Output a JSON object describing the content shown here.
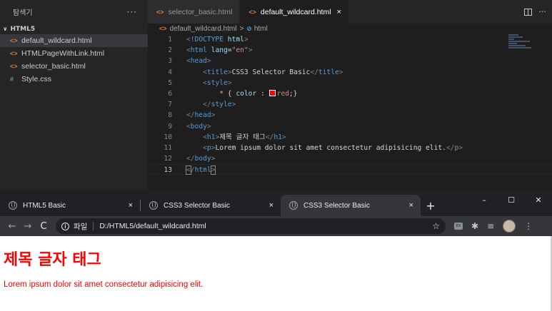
{
  "vscode": {
    "explorer_title": "탐색기",
    "explorer_more": "···",
    "folder_name": "HTML5",
    "files": [
      {
        "name": "default_wildcard.html",
        "type": "html",
        "active": true
      },
      {
        "name": "HTMLPageWithLink.html",
        "type": "html",
        "active": false
      },
      {
        "name": "selector_basic.html",
        "type": "html",
        "active": false
      },
      {
        "name": "Style.css",
        "type": "css",
        "active": false
      }
    ],
    "file_icon_html": "<>",
    "file_icon_css": "#",
    "tabs": [
      {
        "label": "selector_basic.html",
        "active": false
      },
      {
        "label": "default_wildcard.html",
        "active": true
      }
    ],
    "tab_close": "×",
    "tab_more": "···",
    "breadcrumb": {
      "file": "default_wildcard.html",
      "separator": ">",
      "symbol": "html"
    },
    "line_numbers": [
      "1",
      "2",
      "3",
      "4",
      "5",
      "6",
      "7",
      "8",
      "9",
      "10",
      "11",
      "12",
      "13"
    ],
    "current_line": "13",
    "code": {
      "doctype_kw": "!DOCTYPE",
      "doctype_val": "html",
      "html_tag": "html",
      "lang_attr": "lang",
      "lang_val": "\"en\"",
      "head_tag": "head",
      "title_tag": "title",
      "title_text": "CSS3 Selector Basic",
      "style_tag": "style",
      "selector": "*",
      "prop": "color",
      "value": "red",
      "body_tag": "body",
      "h1_tag": "h1",
      "h1_text": "제목 글자 태그",
      "p_tag": "p",
      "p_text": "Lorem ipsum dolor sit amet consectetur adipisicing elit."
    },
    "swatch_color": "#ff0000"
  },
  "chrome": {
    "tabs": [
      {
        "label": "HTML5 Basic",
        "active": false
      },
      {
        "label": "CSS3 Selector Basic",
        "active": false
      },
      {
        "label": "CSS3 Selector Basic",
        "active": true
      }
    ],
    "tab_close": "×",
    "new_tab": "+",
    "window_controls": {
      "minimize": "–",
      "maximize": "☐",
      "close": "✕"
    },
    "nav": {
      "back": "←",
      "forward": "→",
      "reload": "C"
    },
    "omnibox": {
      "info_icon": "i",
      "scheme_label": "파일",
      "url": "D:/HTML5/default_wildcard.html",
      "star": "☆"
    },
    "extensions": {
      "ext_box": "EX",
      "puzzle": "✱",
      "media": "≡",
      "menu": "⋮"
    }
  },
  "webpage": {
    "h1": "제목 글자 태그",
    "p": "Lorem ipsum dolor sit amet consectetur adipisicing elit.",
    "text_color": "#ff0000"
  }
}
